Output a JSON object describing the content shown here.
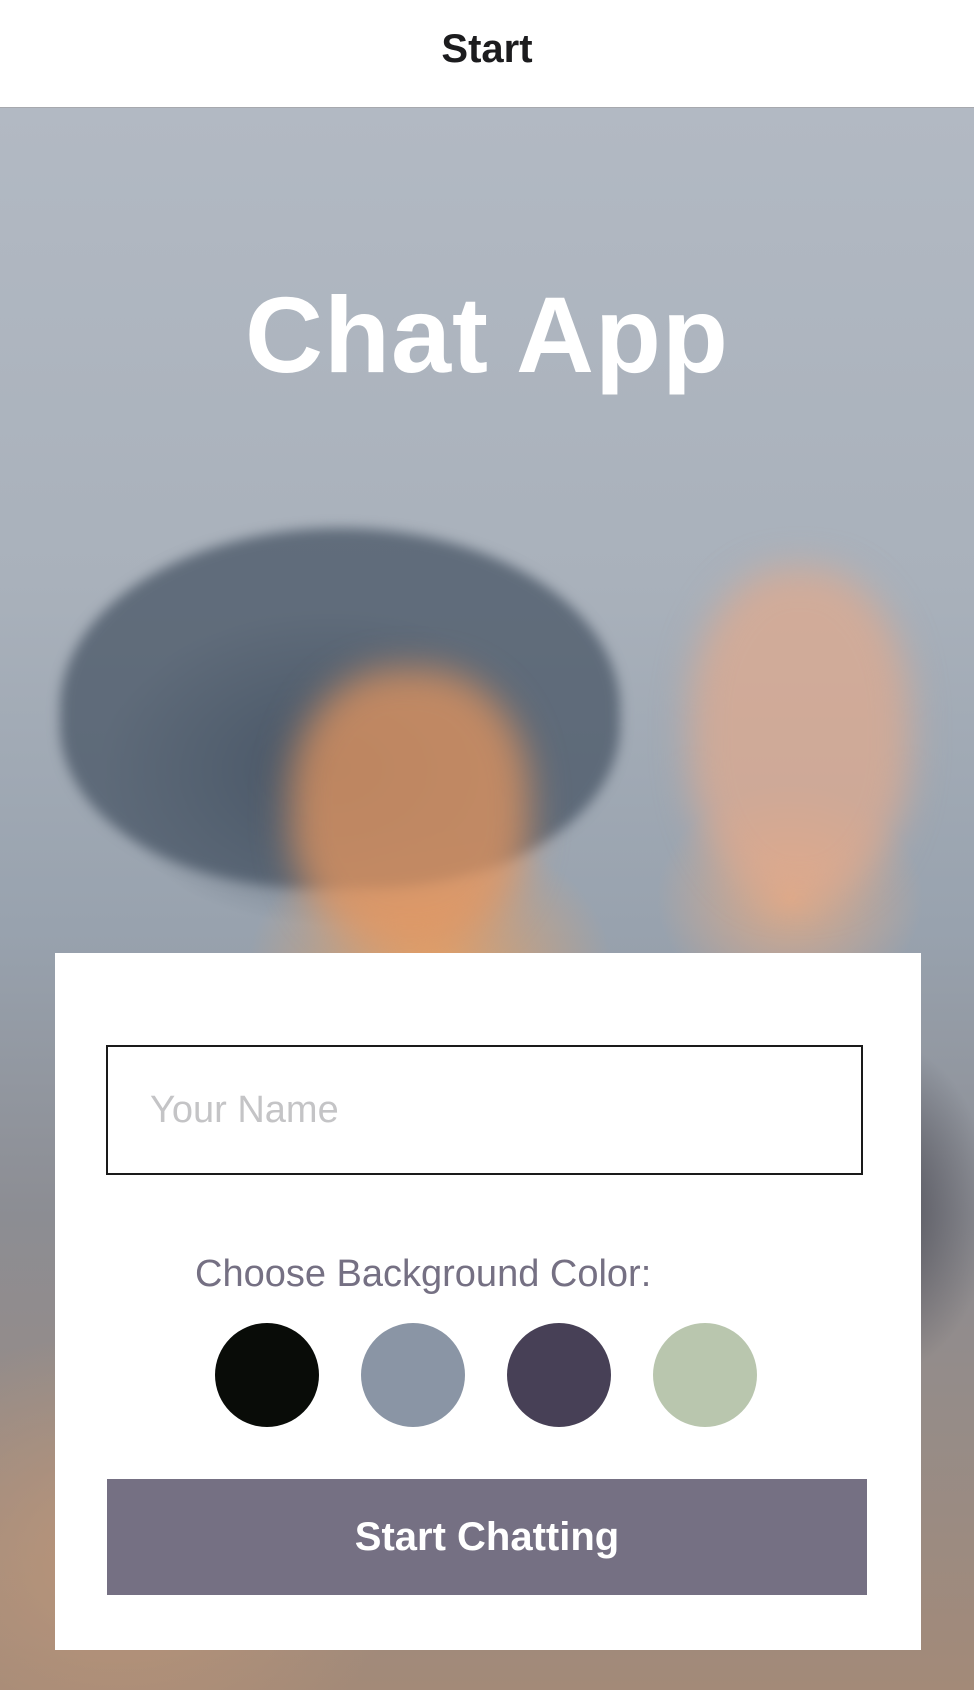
{
  "nav": {
    "title": "Start"
  },
  "hero": {
    "app_title": "Chat App"
  },
  "form": {
    "name_placeholder": "Your Name",
    "name_value": "",
    "color_label": "Choose Background Color:",
    "colors": [
      {
        "name": "black",
        "hex": "#090C08"
      },
      {
        "name": "slate-gray",
        "hex": "#8A95A5"
      },
      {
        "name": "dark-purple",
        "hex": "#474056"
      },
      {
        "name": "sage-green",
        "hex": "#B9C6AE"
      }
    ],
    "start_label": "Start Chatting",
    "button_color": "#757083"
  }
}
